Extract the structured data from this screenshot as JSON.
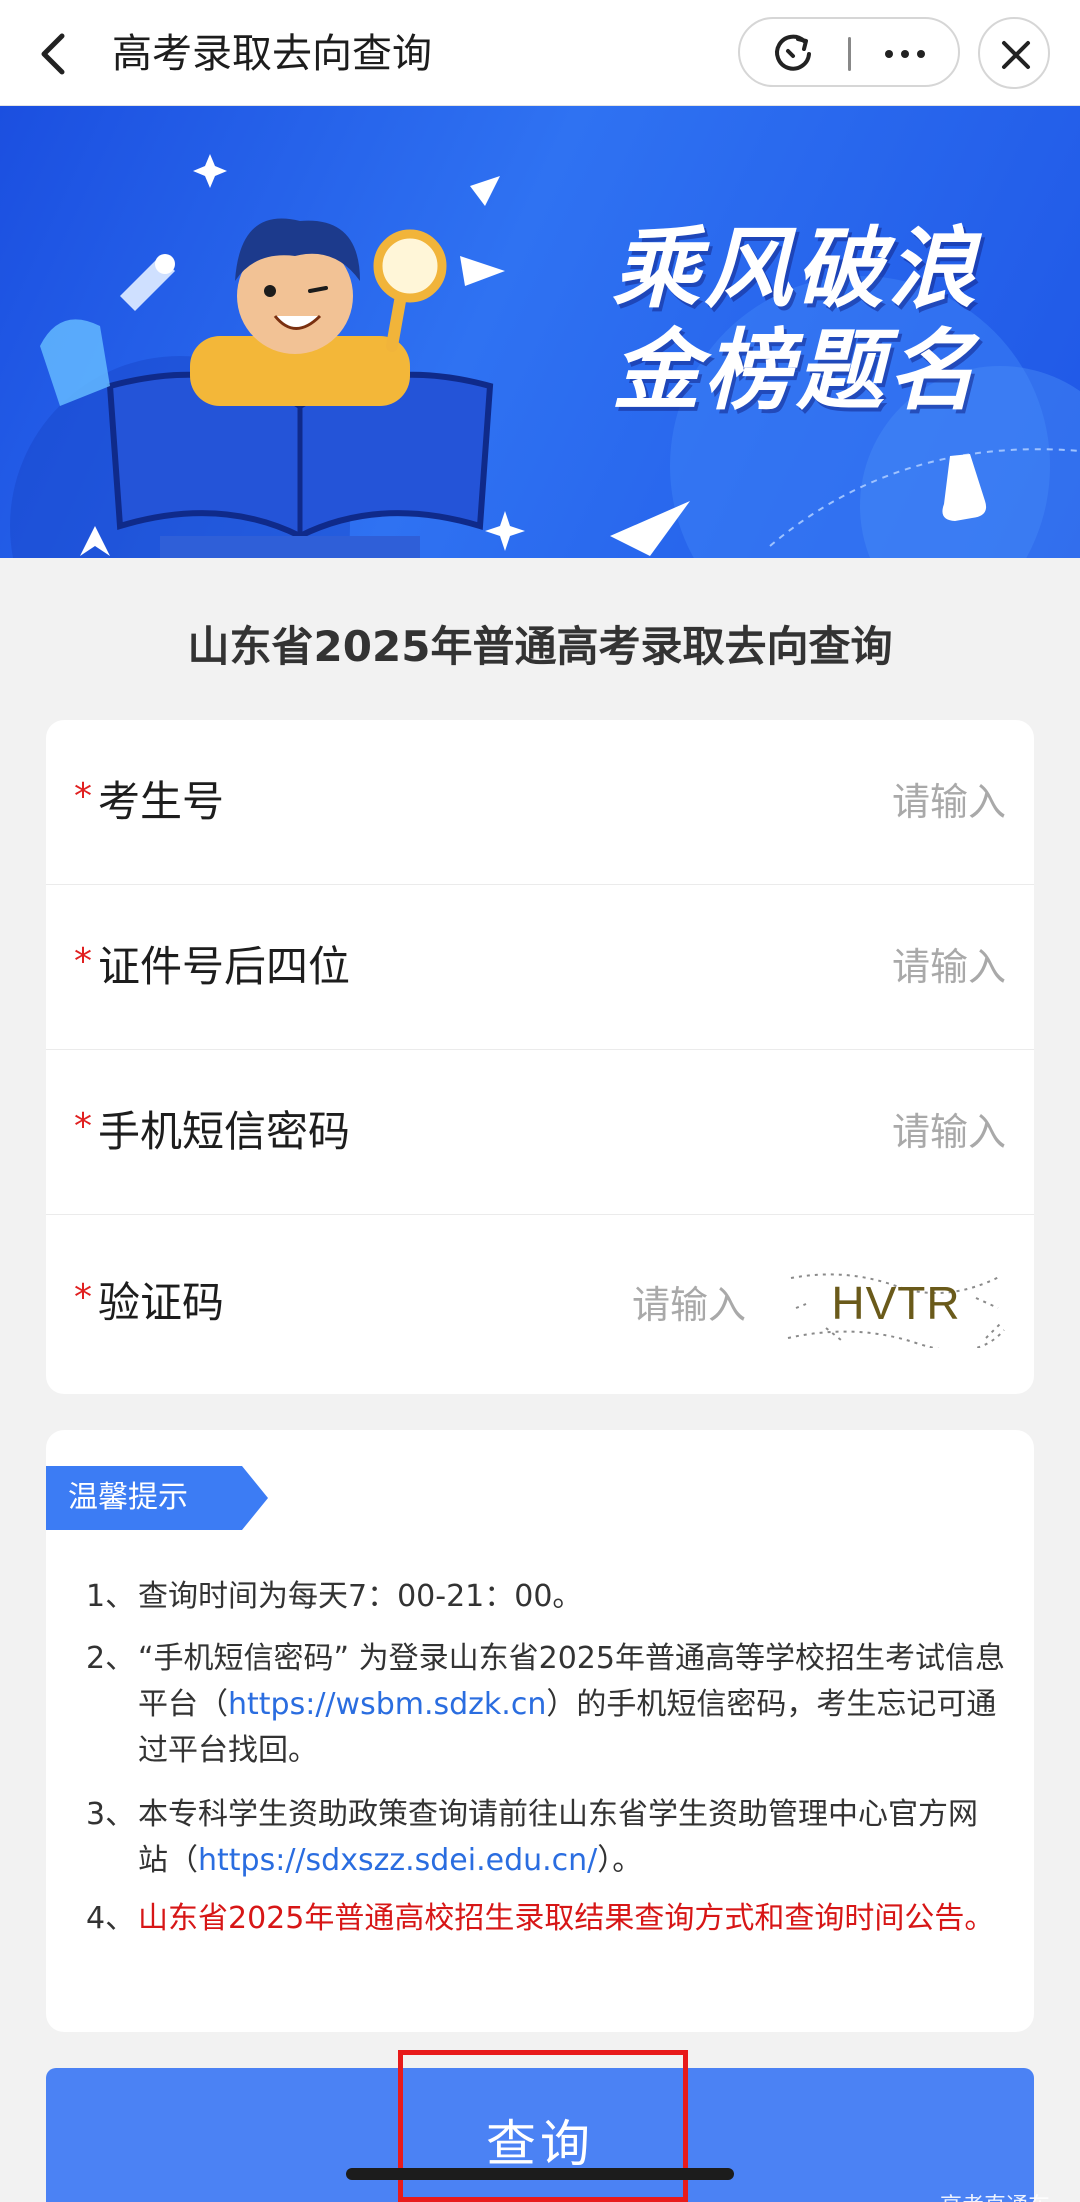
{
  "nav": {
    "title": "高考录取去向查询",
    "back_icon": "chevron-left-icon",
    "refresh_icon": "refresh-icon",
    "more_icon": "more-icon",
    "close_icon": "close-icon"
  },
  "banner": {
    "slogan_line1": "乘风破浪",
    "slogan_line2": "金榜题名",
    "colors": {
      "bg_start": "#1b4fe0",
      "bg_end": "#2f72f2"
    }
  },
  "page": {
    "title": "山东省2025年普通高考录取去向查询"
  },
  "form": {
    "required_mark": "*",
    "fields": [
      {
        "label": "考生号",
        "placeholder": "请输入",
        "value": ""
      },
      {
        "label": "证件号后四位",
        "placeholder": "请输入",
        "value": ""
      },
      {
        "label": "手机短信密码",
        "placeholder": "请输入",
        "value": ""
      },
      {
        "label": "验证码",
        "placeholder": "请输入",
        "value": ""
      }
    ],
    "captcha_text": "HVTR"
  },
  "tips": {
    "tag": "温馨提示",
    "items": [
      {
        "num": "1、",
        "text": "查询时间为每天7：00-21：00。"
      },
      {
        "num": "2、",
        "text_before": "“手机短信密码” 为登录山东省2025年普通高等学校招生考试信息平台（",
        "link": "https://wsbm.sdzk.cn",
        "text_after": "）的手机短信密码，考生忘记可通过平台找回。"
      },
      {
        "num": "3、",
        "text_before": "本专科学生资助政策查询请前往山东省学生资助管理中心官方网站（",
        "link": "https://sdxszz.sdei.edu.cn/",
        "text_after": "）。"
      },
      {
        "num": "4、",
        "text": "山东省2025年普通高校招生录取结果查询方式和查询时间公告。"
      }
    ]
  },
  "actions": {
    "query_label": "查询"
  },
  "watermark": "高考直通车",
  "colors": {
    "primary": "#4b82f4",
    "required": "#e02020",
    "link": "#2a6de0",
    "notice_red": "#d71616",
    "highlight": "#e81b1b"
  }
}
